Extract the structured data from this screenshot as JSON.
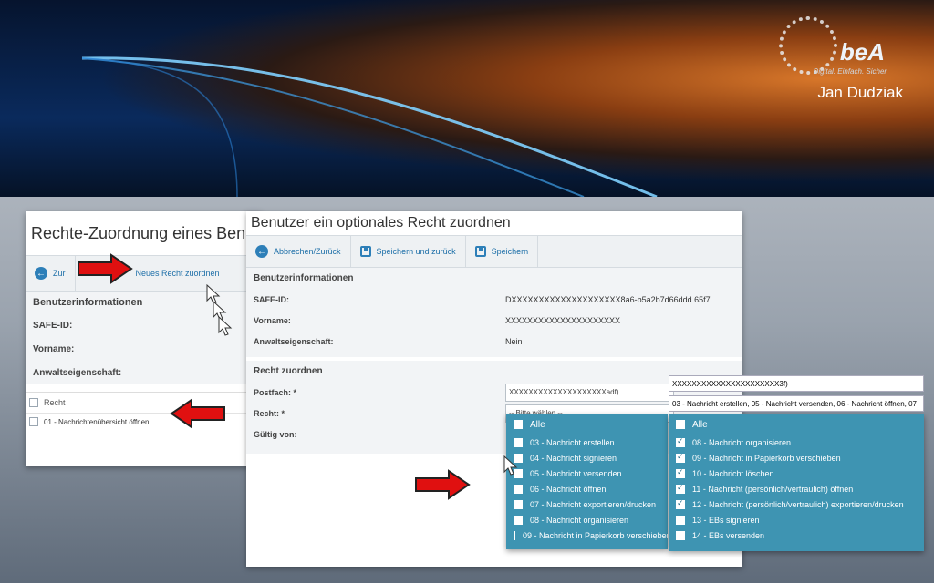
{
  "banner": {
    "brand": "beA",
    "tagline": "Digital. Einfach. Sicher.",
    "presenter": "Jan Dudziak"
  },
  "panel1": {
    "title": "Rechte-Zuordnung eines Benu",
    "toolbar": {
      "back_label": "Zur",
      "new_right_label": "Neues Recht zuordnen"
    },
    "section_heading": "Benutzerinformationen",
    "fields": [
      {
        "label": "SAFE-ID:"
      },
      {
        "label": "Vorname:"
      },
      {
        "label": "Anwaltseigenschaft:"
      }
    ],
    "table": {
      "header": "Recht",
      "rows": [
        "01 - Nachrichtenübersicht öffnen"
      ]
    }
  },
  "panel2": {
    "title": "Benutzer ein optionales Recht zuordnen",
    "toolbar": {
      "cancel_label": "Abbrechen/Zurück",
      "save_back_label": "Speichern und zurück",
      "save_label": "Speichern"
    },
    "user_info_heading": "Benutzerinformationen",
    "safe_id_label": "SAFE-ID:",
    "safe_id_value": "DXXXXXXXXXXXXXXXXXXXX8a6-b5a2b7d66ddd 65f7",
    "firstname_label": "Vorname:",
    "firstname_value": "XXXXXXXXXXXXXXXXXXXXX",
    "lawyer_label": "Anwaltseigenschaft:",
    "lawyer_value": "Nein",
    "assign_heading": "Recht zuordnen",
    "postfach_label": "Postfach: *",
    "postfach_value": "XXXXXXXXXXXXXXXXXXXXadf)",
    "recht_label": "Recht: *",
    "recht_value": "-- Bitte wählen --",
    "valid_from_label": "Gültig von:"
  },
  "dropdown1": {
    "all_label": "Alle",
    "items": [
      "03 - Nachricht erstellen",
      "04 - Nachricht signieren",
      "05 - Nachricht versenden",
      "06 - Nachricht öffnen",
      "07 - Nachricht exportieren/drucken",
      "08 - Nachricht organisieren",
      "09 - Nachricht in Papierkorb verschieben"
    ]
  },
  "dropdown2": {
    "postfach_value": "XXXXXXXXXXXXXXXXXXXXXX3f)",
    "selected_summary": "03 - Nachricht erstellen, 05 - Nachricht versenden, 06 - Nachricht öffnen, 07",
    "all_label": "Alle",
    "items": [
      {
        "label": "08 - Nachricht organisieren",
        "checked": true
      },
      {
        "label": "09 - Nachricht in Papierkorb verschieben",
        "checked": true
      },
      {
        "label": "10 - Nachricht löschen",
        "checked": true
      },
      {
        "label": "11 - Nachricht (persönlich/vertraulich) öffnen",
        "checked": true
      },
      {
        "label": "12 - Nachricht (persönlich/vertraulich) exportieren/drucken",
        "checked": true
      },
      {
        "label": "13 - EBs signieren",
        "checked": false
      },
      {
        "label": "14 - EBs versenden",
        "checked": false
      }
    ]
  },
  "colors": {
    "accent": "#2d7fb8",
    "dropdown_bg": "#3e94b2",
    "arrow": "#e01010"
  }
}
